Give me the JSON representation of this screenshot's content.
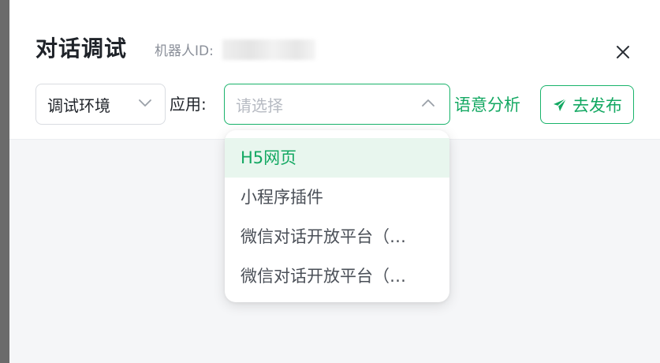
{
  "dialog": {
    "title": "对话调试",
    "robot_id_label": "机器人ID:"
  },
  "toolbar": {
    "env_select_value": "调试环境",
    "app_label": "应用:",
    "app_select_placeholder": "请选择",
    "semantic_analysis_label": "语意分析",
    "publish_label": "去发布"
  },
  "dropdown": {
    "items": [
      {
        "label": "H5网页",
        "selected": true
      },
      {
        "label": "小程序插件",
        "selected": false
      },
      {
        "label": "微信对话开放平台（…",
        "selected": false
      },
      {
        "label": "微信对话开放平台（…",
        "selected": false
      }
    ]
  },
  "colors": {
    "accent": "#13a862",
    "border_active": "#19b36b",
    "selected_bg": "#e8f6ee"
  },
  "icons": {
    "close": "close-icon",
    "env_chevron": "chevron-down-icon",
    "app_chevron": "chevron-up-icon",
    "publish": "paper-plane-icon"
  }
}
